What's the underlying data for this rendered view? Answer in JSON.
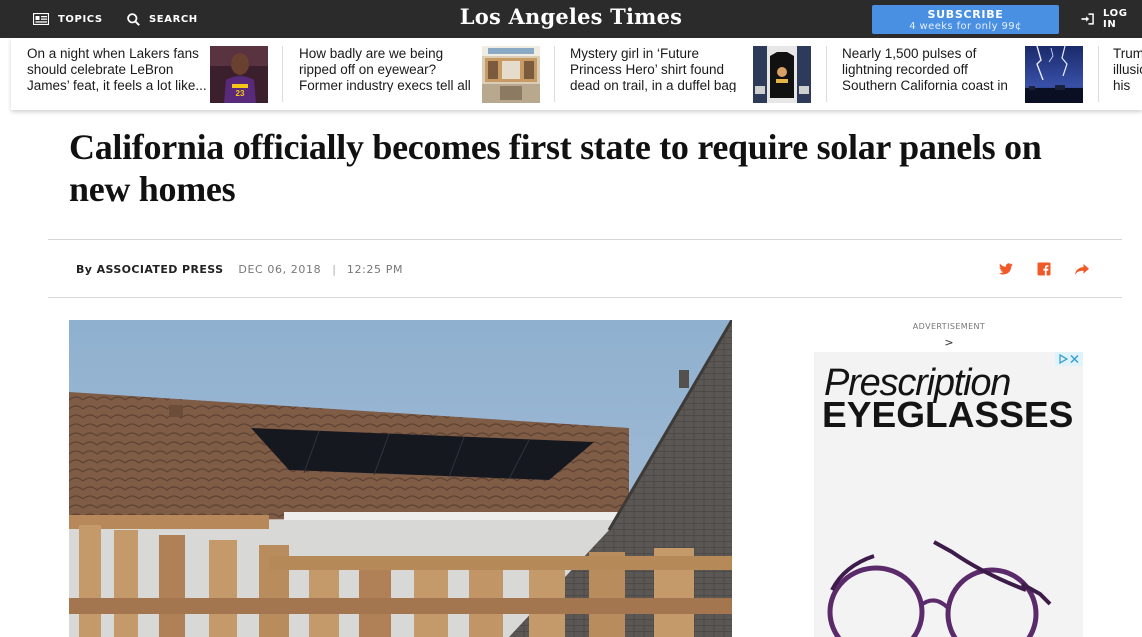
{
  "nav": {
    "topics_label": "TOPICS",
    "search_label": "SEARCH",
    "logo_text": "Los Angeles Times",
    "subscribe_label": "SUBSCRIBE",
    "subscribe_offer": "4 weeks for only 99¢",
    "login_label": "LOG IN"
  },
  "recirc": {
    "items": [
      {
        "text": "On a night when Lakers fans should celebrate LeBron James’ feat, it feels a lot like...",
        "thumb": "lebron-photo"
      },
      {
        "text": "How badly are we being ripped off on eyewear? Former industry execs tell all",
        "thumb": "lenscrafters-store-photo"
      },
      {
        "text": "Mystery girl in ‘Future Princess Hero’ shirt found dead on trail, in a duffel bag",
        "thumb": "shirt-photo"
      },
      {
        "text": "Nearly 1,500 pulses of lightning recorded off Southern California coast in Friday storm",
        "thumb": "lightning-photo"
      },
      {
        "text": "Trump illusion his m...",
        "thumb": ""
      }
    ]
  },
  "article": {
    "headline": "California officially becomes first state to require solar panels on new homes",
    "byline": "By ASSOCIATED PRESS",
    "date": "DEC 06, 2018",
    "separator": "|",
    "time": "12:25 PM"
  },
  "share": {
    "twitter": "twitter-icon",
    "facebook": "facebook-icon",
    "share": "share-icon",
    "color": "#f05a28"
  },
  "ad": {
    "label": "ADVERTISEMENT",
    "arrow": ">",
    "title_line1": "Prescription",
    "title_line2": "EYEGLASSES"
  },
  "colors": {
    "nav_bg": "#2b2b2b",
    "subscribe_bg": "#4a90e2",
    "accent": "#f05a28"
  }
}
